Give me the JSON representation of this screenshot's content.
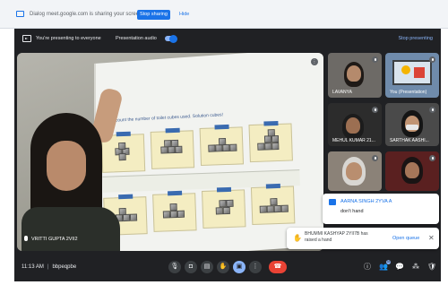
{
  "share_bar": {
    "text": "Dialog rneet.google.com is sharing your screen.",
    "stop_label": "Stop sharing",
    "hide_label": "Hide"
  },
  "present_bar": {
    "presenting_text": "You're presenting to everyone",
    "audio_label": "Presentation audio",
    "stop_presenting_label": "Stop presenting"
  },
  "main_video": {
    "book_header": "Let's count the number of toilet cubes used. Solution cubes!",
    "name": "VRITTI GUPTA 2VII2"
  },
  "tiles": [
    {
      "name": "LAVANYA"
    },
    {
      "name": "You (Presentation)"
    },
    {
      "name": "MEHUL KUMAR 21..."
    },
    {
      "name": "SARTHAK AASHI..."
    },
    {
      "name": ""
    },
    {
      "name": ""
    }
  ],
  "chat_toast": {
    "sender": "AARNA SINGH 2YVA A",
    "message": "don't hand"
  },
  "hand_toast": {
    "text": "BHUMMI KASHYAP 2YII7B has raised a hand",
    "open_queue_label": "Open queue"
  },
  "bottom_bar": {
    "time": "11:13 AM",
    "meeting_code": "bbpeqpbe",
    "participants_count": "35"
  },
  "colors": {
    "accent": "#1a73e8",
    "end_call": "#ea4335",
    "meet_bg": "#202124"
  }
}
